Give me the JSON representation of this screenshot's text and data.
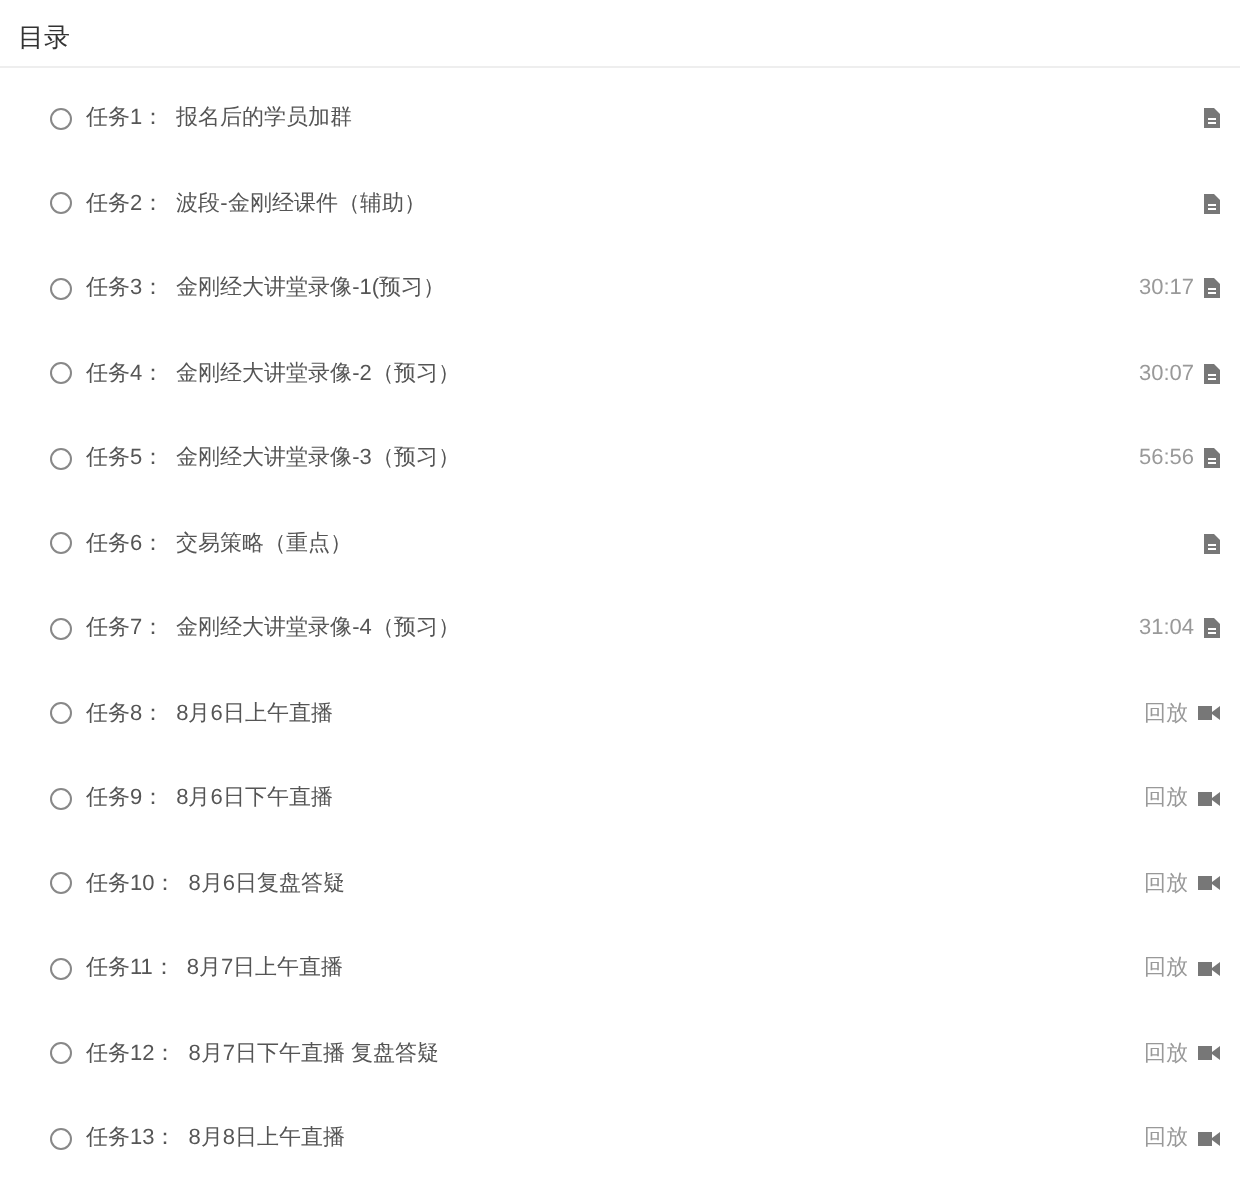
{
  "heading": "目录",
  "tasks": [
    {
      "label": "任务1：",
      "title": "报名后的学员加群",
      "kind": "document"
    },
    {
      "label": "任务2：",
      "title": "波段-金刚经课件（辅助）",
      "kind": "document"
    },
    {
      "label": "任务3：",
      "title": "金刚经大讲堂录像-1(预习）",
      "kind": "document",
      "duration": "30:17"
    },
    {
      "label": "任务4：",
      "title": "金刚经大讲堂录像-2（预习）",
      "kind": "document",
      "duration": "30:07"
    },
    {
      "label": "任务5：",
      "title": "金刚经大讲堂录像-3（预习）",
      "kind": "document",
      "duration": "56:56"
    },
    {
      "label": "任务6：",
      "title": "交易策略（重点）",
      "kind": "document"
    },
    {
      "label": "任务7：",
      "title": "金刚经大讲堂录像-4（预习）",
      "kind": "document",
      "duration": "31:04"
    },
    {
      "label": "任务8：",
      "title": "8月6日上午直播",
      "kind": "video",
      "duration": "回放"
    },
    {
      "label": "任务9：",
      "title": "8月6日下午直播",
      "kind": "video",
      "duration": "回放"
    },
    {
      "label": "任务10：",
      "title": "8月6日复盘答疑",
      "kind": "video",
      "duration": "回放"
    },
    {
      "label": "任务11：",
      "title": "8月7日上午直播",
      "kind": "video",
      "duration": "回放"
    },
    {
      "label": "任务12：",
      "title": "8月7日下午直播 复盘答疑",
      "kind": "video",
      "duration": "回放"
    },
    {
      "label": "任务13：",
      "title": "8月8日上午直播",
      "kind": "video",
      "duration": "回放"
    }
  ]
}
